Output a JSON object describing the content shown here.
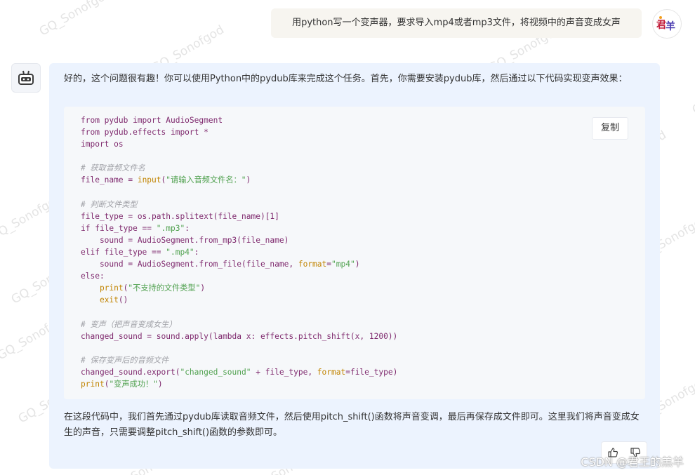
{
  "user_message": {
    "text": "用python写一个变声器，要求导入mp4或者mp3文件，将视频中的声音变成女声",
    "avatar_glyphs": "君羊"
  },
  "bot_message": {
    "intro": "好的，这个问题很有趣！你可以使用Python中的pydub库来完成这个任务。首先，你需要安装pydub库，然后通过以下代码实现变声效果：",
    "copy_label": "复制",
    "code_lines": [
      "from pydub import AudioSegment",
      "from pydub.effects import *",
      "import os",
      "",
      "# 获取音频文件名",
      "file_name = input(\"请输入音频文件名：\")",
      "",
      "# 判断文件类型",
      "file_type = os.path.splitext(file_name)[1]",
      "if file_type == \".mp3\":",
      "    sound = AudioSegment.from_mp3(file_name)",
      "elif file_type == \".mp4\":",
      "    sound = AudioSegment.from_file(file_name, format=\"mp4\")",
      "else:",
      "    print(\"不支持的文件类型\")",
      "    exit()",
      "",
      "# 变声（把声音变成女生）",
      "changed_sound = sound.apply(lambda x: effects.pitch_shift(x, 1200))",
      "",
      "# 保存变声后的音频文件",
      "changed_sound.export(\"changed_sound\" + file_type, format=file_type)",
      "print(\"变声成功！\")"
    ],
    "outro": "在这段代码中，我们首先通过pydub库读取音频文件，然后使用pitch_shift()函数将声音变调，最后再保存成文件即可。这里我们将声音变成女生的声音，只需要调整pitch_shift()函数的参数即可。"
  },
  "watermark": {
    "text": "GQ_Sonofgod",
    "csdn": "CSDN @君王的羔羊"
  },
  "icons": {
    "bot_avatar": "robot-icon",
    "like": "thumbs-up-icon",
    "dislike": "thumbs-down-icon"
  },
  "colors": {
    "user_bubble": "#f7f5f0",
    "bot_bubble": "#ecf3fe",
    "code_bg": "#f6f8fa"
  }
}
